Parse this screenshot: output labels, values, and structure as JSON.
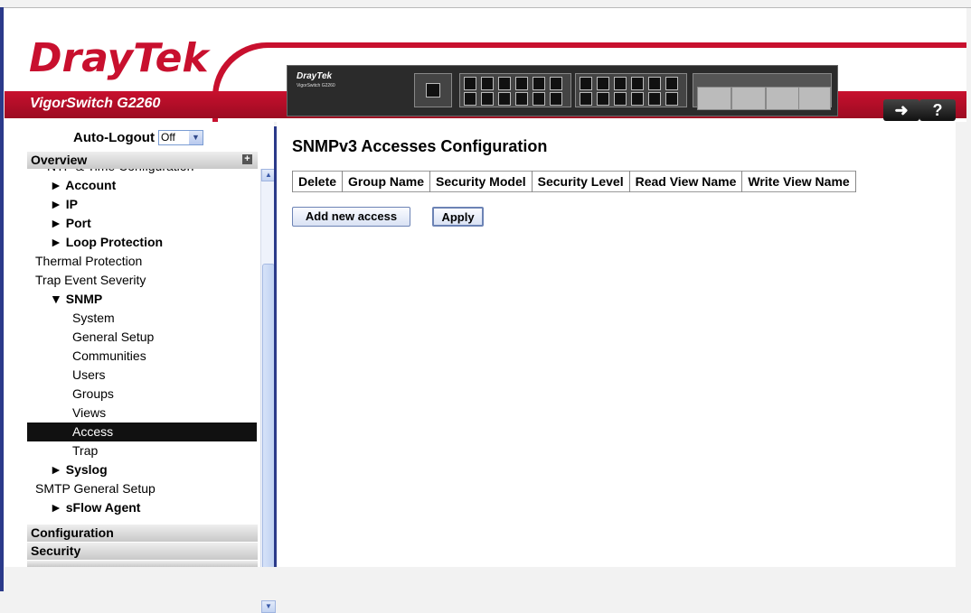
{
  "header": {
    "brand": "DrayTek",
    "model": "VigorSwitch G2260",
    "device_brand": "DrayTek",
    "device_model": "VigorSwitch G2260",
    "logout_icon": "logout-icon",
    "help_icon": "help-icon",
    "help_label": "?"
  },
  "sidebar": {
    "autologout_label": "Auto-Logout",
    "autologout_value": "Off",
    "section_overview": "Overview",
    "section_configuration": "Configuration",
    "section_security": "Security",
    "menu": [
      {
        "label": "NTP & Time Configuration",
        "bold": false
      },
      {
        "label": "► Account",
        "bold": true
      },
      {
        "label": "► IP",
        "bold": true
      },
      {
        "label": "► Port",
        "bold": true
      },
      {
        "label": "► Loop Protection",
        "bold": true
      },
      {
        "label": "Thermal Protection",
        "bold": false
      },
      {
        "label": "Trap Event Severity",
        "bold": false
      },
      {
        "label": "▼ SNMP",
        "bold": true
      },
      {
        "label": "System",
        "bold": false
      },
      {
        "label": "General Setup",
        "bold": false
      },
      {
        "label": "Communities",
        "bold": false
      },
      {
        "label": "Users",
        "bold": false
      },
      {
        "label": "Groups",
        "bold": false
      },
      {
        "label": "Views",
        "bold": false
      },
      {
        "label": "Access",
        "bold": false,
        "selected": true
      },
      {
        "label": "Trap",
        "bold": false
      },
      {
        "label": "► Syslog",
        "bold": true
      },
      {
        "label": "SMTP General Setup",
        "bold": false
      },
      {
        "label": "► sFlow Agent",
        "bold": true
      }
    ]
  },
  "main": {
    "title": "SNMPv3 Accesses Configuration",
    "columns": [
      "Delete",
      "Group Name",
      "Security Model",
      "Security Level",
      "Read View Name",
      "Write View Name"
    ],
    "add_button": "Add new access",
    "apply_button": "Apply"
  },
  "colors": {
    "brand_red": "#c8102e",
    "frame_blue": "#2b3a8a",
    "selected_bg": "#111111"
  }
}
